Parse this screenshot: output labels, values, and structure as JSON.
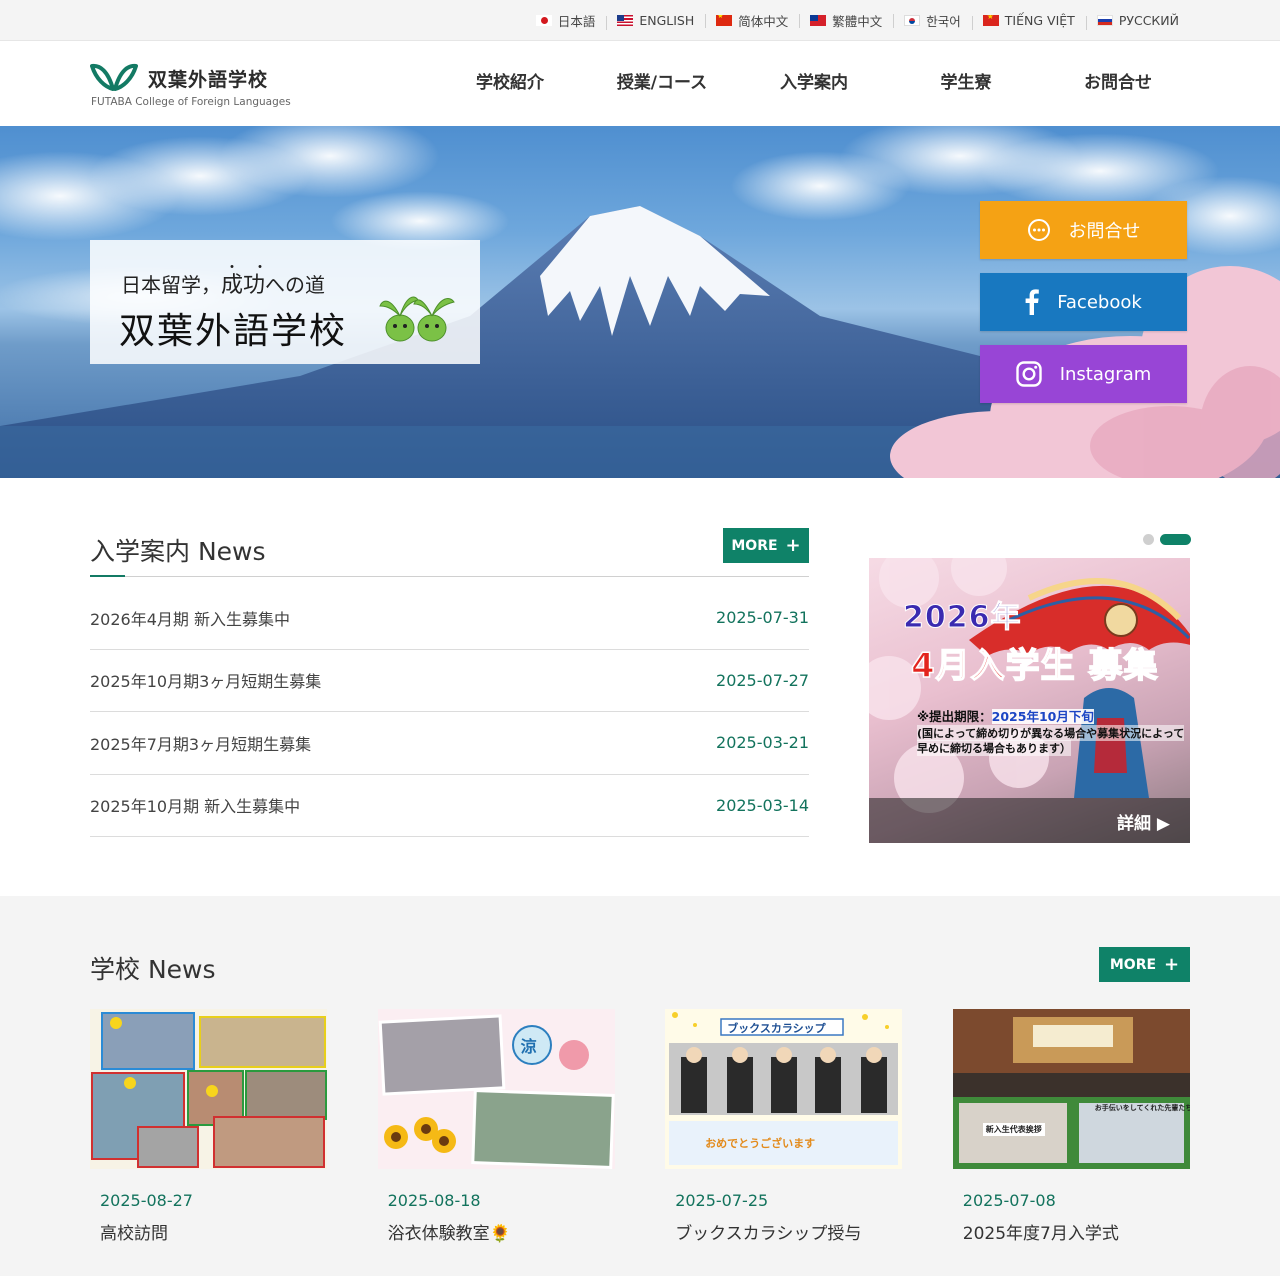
{
  "languages": [
    {
      "label": "日本語",
      "flag": "flag-jp"
    },
    {
      "label": "ENGLISH",
      "flag": "flag-us"
    },
    {
      "label": "简体中文",
      "flag": "flag-cn"
    },
    {
      "label": "繁體中文",
      "flag": "flag-tw"
    },
    {
      "label": "한국어",
      "flag": "flag-kr"
    },
    {
      "label": "TIẾNG VIỆT",
      "flag": "flag-vn"
    },
    {
      "label": "РУССКИЙ",
      "flag": "flag-ru"
    }
  ],
  "logo": {
    "name": "双葉外語学校",
    "sub": "FUTABA College of Foreign Languages",
    "color": "#137a64"
  },
  "nav": [
    "学校紹介",
    "授業/コース",
    "入学案内",
    "学生寮",
    "お問合せ"
  ],
  "hero": {
    "line1_pre": "日本留学，",
    "line1_em": "成功",
    "line1_post": "への道",
    "line2": "双葉外語学校"
  },
  "side_buttons": {
    "contact": {
      "label": "お問合せ",
      "icon": "chat-icon",
      "color": "#f5a214"
    },
    "facebook": {
      "label": "Facebook",
      "icon": "facebook-icon",
      "color": "#1878c0"
    },
    "instagram": {
      "label": "Instagram",
      "icon": "instagram-icon",
      "color": "#9845d6"
    }
  },
  "admission_news": {
    "title": "入学案内 News",
    "more_label": "MORE",
    "items": [
      {
        "title": "2026年4月期 新入生募集中",
        "date": "2025-07-31"
      },
      {
        "title": "2025年10月期3ヶ月短期生募集",
        "date": "2025-07-27"
      },
      {
        "title": "2025年7月期3ヶ月短期生募集",
        "date": "2025-03-21"
      },
      {
        "title": "2025年10月期 新入生募集中",
        "date": "2025-03-14"
      }
    ]
  },
  "banner": {
    "year": "2026年",
    "headline": "4月入学生 募集",
    "deadline_label": "※提出期限：",
    "deadline_value": "2025年10月下旬",
    "note1": "(国によって締め切りが異なる場合や募集状況によって",
    "note2": "早めに締切る場合もあります）",
    "detail_label": "詳細 ▶"
  },
  "school_news": {
    "title": "学校 News",
    "more_label": "MORE",
    "items": [
      {
        "date": "2025-08-27",
        "title": "高校訪問"
      },
      {
        "date": "2025-08-18",
        "title": "浴衣体験教室🌻"
      },
      {
        "date": "2025-07-25",
        "title": "ブックスカラシップ授与"
      },
      {
        "date": "2025-07-08",
        "title": "2025年度7月入学式"
      }
    ],
    "thumb_texts": {
      "card2_badge": "涼",
      "card3_banner": "ブックスカラシップ",
      "card3_footer": "おめでとうございます",
      "card4_left": "新入生代表挨拶",
      "card4_right": "お手伝いをしてくれた先輩たち"
    }
  },
  "accent_color": "#0f8268"
}
